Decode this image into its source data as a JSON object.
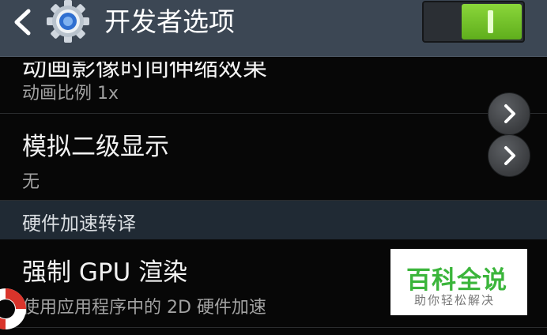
{
  "action_bar": {
    "title": "开发者选项",
    "master_switch_on": true
  },
  "settings": {
    "animation_scale": {
      "title": "动画影像时间伸缩效果",
      "value": "动画比例 1x"
    },
    "simulate_displays": {
      "title": "模拟二级显示",
      "value": "无"
    },
    "section_header": "硬件加速转译",
    "force_gpu": {
      "title": "强制 GPU 渲染",
      "summary": "使用应用程序中的 2D 硬件加速"
    }
  },
  "watermark": {
    "main": "百科全说",
    "sub": "助你轻松解决"
  },
  "colors": {
    "action_bar": "#3c4754",
    "section_header": "#202a34",
    "toggle_on": "#6cc12a",
    "watermark_text": "#3bb53b"
  },
  "icons": [
    "back-arrow-icon",
    "gear-icon",
    "chevron-right-icon",
    "lifebuoy-icon"
  ]
}
